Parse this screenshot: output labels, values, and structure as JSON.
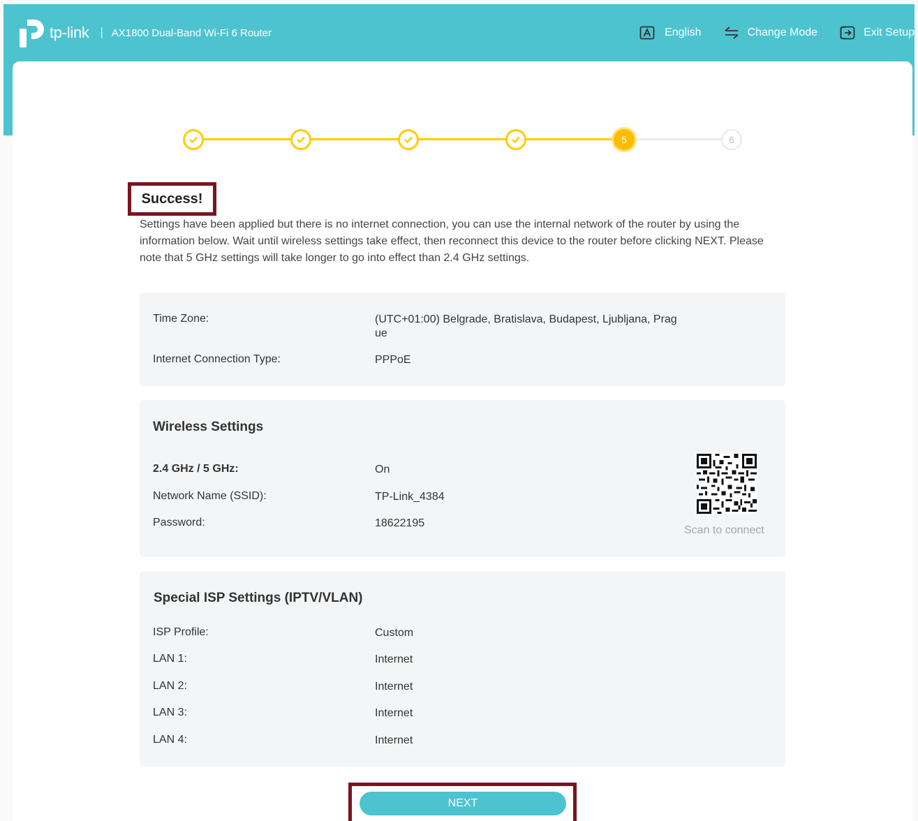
{
  "header": {
    "brand": "tp-link",
    "separator": "|",
    "model": "AX1800 Dual-Band Wi-Fi 6 Router",
    "language_label": "English",
    "change_mode_label": "Change Mode",
    "exit_setup_label": "Exit Setup"
  },
  "stepper": {
    "steps": [
      {
        "label": "",
        "state": "done"
      },
      {
        "label": "",
        "state": "done"
      },
      {
        "label": "",
        "state": "done"
      },
      {
        "label": "",
        "state": "done"
      },
      {
        "label": "5",
        "state": "current"
      },
      {
        "label": "6",
        "state": "todo"
      }
    ]
  },
  "result": {
    "title": "Success!",
    "message": "Settings have been applied but there is no internet connection, you can use the internal network of the router by using the information below. Wait until wireless settings take effect, then reconnect this device to the router before clicking NEXT. Please note that 5 GHz settings will take longer to go into effect than 2.4 GHz settings."
  },
  "summary": {
    "time_zone_label": "Time Zone:",
    "time_zone_value": "(UTC+01:00) Belgrade, Bratislava, Budapest, Ljubljana, Prague",
    "connection_type_label": "Internet Connection Type:",
    "connection_type_value": "PPPoE"
  },
  "wireless": {
    "title": "Wireless Settings",
    "band_label": "2.4 GHz / 5 GHz:",
    "band_value": "On",
    "ssid_label": "Network Name (SSID):",
    "ssid_value": "TP-Link_4384",
    "password_label": "Password:",
    "password_value": "18622195",
    "scan_label": "Scan to connect"
  },
  "isp": {
    "title": "Special ISP Settings (IPTV/VLAN)",
    "rows": [
      {
        "label": "ISP Profile:",
        "value": "Custom"
      },
      {
        "label": "LAN 1:",
        "value": "Internet"
      },
      {
        "label": "LAN 2:",
        "value": "Internet"
      },
      {
        "label": "LAN 3:",
        "value": "Internet"
      },
      {
        "label": "LAN 4:",
        "value": "Internet"
      }
    ]
  },
  "actions": {
    "next_label": "NEXT"
  },
  "colors": {
    "brand_teal": "#4dc3d0",
    "step_yellow": "#ffcc00",
    "highlight_frame": "#7a1420"
  }
}
